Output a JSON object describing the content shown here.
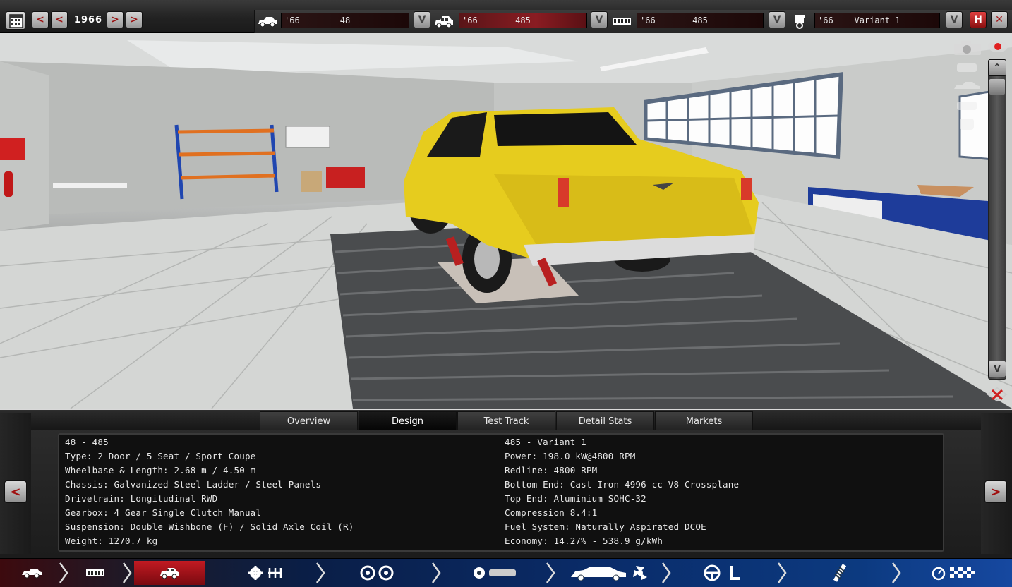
{
  "year_selector": {
    "year": "1966",
    "prev_prev": "<",
    "prev": "<",
    "next": ">",
    "next_next": ">"
  },
  "selectors": [
    {
      "icon": "car-body-icon",
      "year": "'66",
      "name": "48",
      "dropdown": "V"
    },
    {
      "icon": "car-trim-icon",
      "year": "'66",
      "name": "485",
      "dropdown": "V"
    },
    {
      "icon": "engine-block-icon",
      "year": "'66",
      "name": "485",
      "dropdown": "V"
    },
    {
      "icon": "piston-icon",
      "year": "'66",
      "name": "Variant 1",
      "dropdown": "V"
    }
  ],
  "window_buttons": {
    "save": "H",
    "close": "✕"
  },
  "viewport": {
    "scroll_up": "^",
    "scroll_down": "V"
  },
  "tabs": [
    {
      "label": "Overview"
    },
    {
      "label": "Design"
    },
    {
      "label": "Test Track"
    },
    {
      "label": "Detail Stats"
    },
    {
      "label": "Markets"
    }
  ],
  "active_tab": "Design",
  "car_info": {
    "left": [
      "48 - 485",
      "Type: 2 Door / 5 Seat / Sport Coupe",
      "Wheelbase & Length: 2.68 m / 4.50 m",
      "Chassis: Galvanized Steel Ladder / Steel Panels",
      "Drivetrain: Longitudinal RWD",
      "Gearbox: 4 Gear Single Clutch Manual",
      "Suspension: Double Wishbone (F) / Solid Axle Coil (R)",
      "Weight: 1270.7 kg"
    ],
    "right": [
      "485 - Variant 1",
      "Power: 198.0 kW@4800 RPM",
      "Redline: 4800 RPM",
      "Bottom End: Cast Iron 4996 cc V8 Crossplane",
      "Top End: Aluminium SOHC-32",
      "Compression 8.4:1",
      "Fuel System: Naturally Aspirated DCOE",
      "Economy: 14.27% - 538.9 g/kWh"
    ]
  },
  "nav_arrows": {
    "left": "<",
    "right": ">"
  },
  "bottom_nav": [
    {
      "icon": "car-model-icon"
    },
    {
      "icon": "chassis-frame-icon"
    },
    {
      "icon": "trim-car-icon",
      "active": true
    },
    {
      "icon": "engine-gear-icon"
    },
    {
      "icon": "wheels-icon"
    },
    {
      "icon": "body-design-icon"
    },
    {
      "icon": "aero-fan-icon"
    },
    {
      "icon": "interior-seat-icon"
    },
    {
      "icon": "suspension-icon"
    },
    {
      "icon": "testing-flag-icon"
    }
  ],
  "colors": {
    "accent_red": "#a01010",
    "car_yellow": "#e8d020",
    "nav_blue": "#0a2c6a"
  }
}
